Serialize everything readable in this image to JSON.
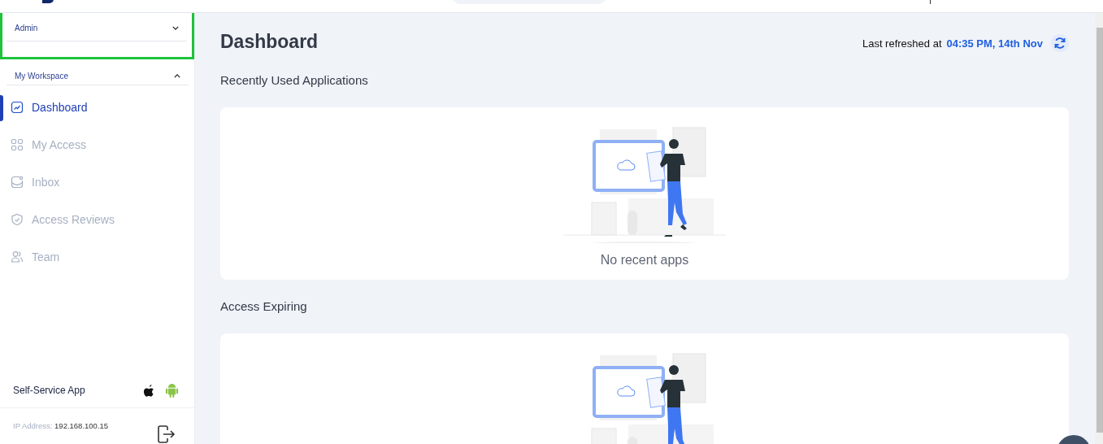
{
  "sidebar": {
    "role_dropdown": {
      "label": "Admin",
      "expanded": false
    },
    "section": {
      "label": "My Workspace",
      "expanded": true
    },
    "items": [
      {
        "label": "Dashboard",
        "kind": "chart",
        "selected": true
      },
      {
        "label": "My Access",
        "kind": "grid",
        "selected": false
      },
      {
        "label": "Inbox",
        "kind": "inbox",
        "selected": false
      },
      {
        "label": "Access Reviews",
        "kind": "shield",
        "selected": false
      },
      {
        "label": "Team",
        "kind": "team",
        "selected": false
      }
    ],
    "app_promo": {
      "label": "Self-Service App"
    },
    "ip_address": {
      "label": "IP Address:",
      "value": "192.168.100.15"
    }
  },
  "page": {
    "title": "Dashboard",
    "refreshed_label": "Last refreshed at",
    "refreshed_time": "04:35 PM, 14th Nov"
  },
  "sections": [
    {
      "title": "Recently Used Applications",
      "empty_text": "No recent apps"
    },
    {
      "title": "Access Expiring"
    }
  ]
}
